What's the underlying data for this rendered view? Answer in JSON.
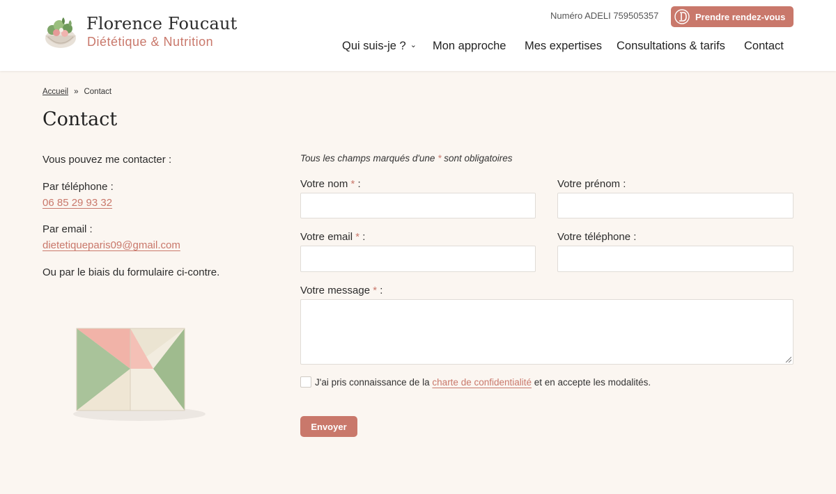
{
  "header": {
    "brand_name": "Florence Foucaut",
    "brand_sub": "Diététique & Nutrition",
    "adeli": "Numéro ADELI 759505357",
    "cta_label": "Prendre rendez-vous",
    "nav": [
      {
        "label": "Qui suis-je ?",
        "has_dropdown": true
      },
      {
        "label": "Mon approche"
      },
      {
        "label": "Mes expertises"
      },
      {
        "label": "Consultations & tarifs"
      },
      {
        "label": "Contact"
      }
    ]
  },
  "breadcrumb": {
    "home": "Accueil",
    "separator": "»",
    "current": "Contact"
  },
  "page_title": "Contact",
  "left": {
    "intro": "Vous pouvez me contacter :",
    "phone_label": "Par téléphone :",
    "phone": "06 85 29 93 32",
    "email_label": "Par email :",
    "email": "dietetiqueparis09@gmail.com",
    "form_note": "Ou par le biais du formulaire ci-contre."
  },
  "form": {
    "required_note_before": "Tous les champs marqués d'une ",
    "required_star": "*",
    "required_note_after": " sont obligatoires",
    "nom_label": "Votre nom",
    "prenom_label": "Votre prénom :",
    "email_label": "Votre email",
    "telephone_label": "Votre téléphone :",
    "message_label": "Votre message",
    "label_suffix": " :",
    "nom_value": "",
    "prenom_value": "",
    "email_value": "",
    "telephone_value": "",
    "message_value": "",
    "consent_before": "J'ai pris connaissance de la ",
    "consent_link": "charte de confidentialité",
    "consent_after": " et en accepte les modalités.",
    "consent_checked": false,
    "submit_label": "Envoyer"
  },
  "colors": {
    "accent": "#c9786b",
    "background": "#fbf6f1",
    "header_bg": "#ffffff"
  }
}
